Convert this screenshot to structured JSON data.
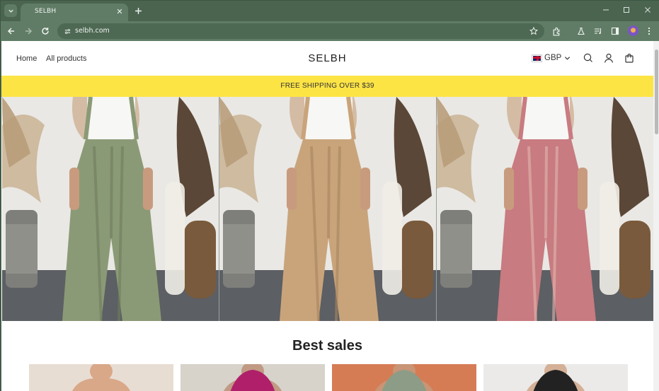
{
  "browser": {
    "tab_title": "SELBH",
    "url": "selbh.com"
  },
  "site": {
    "logo": "SELBH",
    "nav": [
      "Home",
      "All products"
    ],
    "currency": "GBP",
    "banner": "FREE SHIPPING OVER $39",
    "section_title": "Best sales"
  },
  "hero": {
    "panels": [
      {
        "name": "sage-overalls",
        "pants_color": "#8b9a76",
        "pants_shade": "#6f7d5e"
      },
      {
        "name": "tan-overalls",
        "pants_color": "#c9a47b",
        "pants_shade": "#a9865f"
      },
      {
        "name": "pink-overalls",
        "pants_color": "#c87b80",
        "pants_shade": "#e2b7b0"
      }
    ]
  },
  "products": [
    {
      "bg": "#e8ddd3",
      "skin": "#d9a888"
    },
    {
      "bg": "#d7d3cb",
      "skin": "#c19a84",
      "top": "#b0206a"
    },
    {
      "bg": "#d67c55",
      "skin": "#c89576",
      "top": "#8d9c86"
    },
    {
      "bg": "#ebeae8",
      "skin": "#d4b096",
      "top": "#222222"
    }
  ]
}
